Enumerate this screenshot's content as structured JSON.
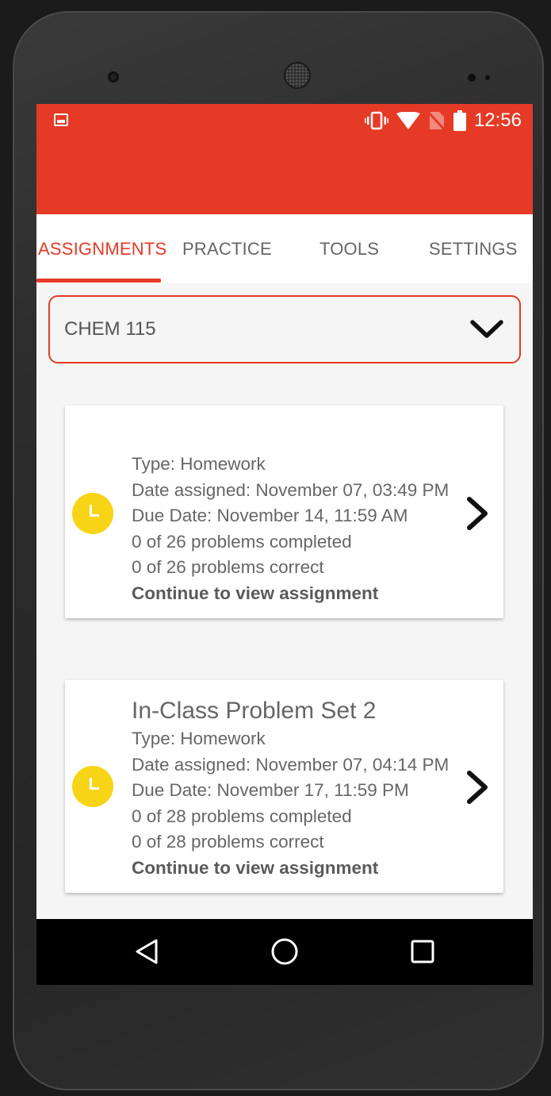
{
  "status_bar": {
    "time": "12:56",
    "icons": [
      "image-icon",
      "vibrate-icon",
      "wifi-icon",
      "no-sim-icon",
      "battery-icon"
    ]
  },
  "tabs": [
    {
      "label": "ASSIGNMENTS",
      "active": true
    },
    {
      "label": "PRACTICE",
      "active": false
    },
    {
      "label": "TOOLS",
      "active": false
    },
    {
      "label": "SETTINGS",
      "active": false
    }
  ],
  "course_selector": {
    "value": "CHEM 115",
    "icon": "chevron-down-icon"
  },
  "assignments": [
    {
      "title": "",
      "type": "Type: Homework",
      "date_assigned": "Date assigned: November 07, 03:49 PM",
      "due_date": "Due Date: November 14, 11:59 AM",
      "completed": "0 of 26 problems completed",
      "correct": "0 of 26 problems correct",
      "cta": "Continue to view assignment",
      "status_icon": "clock-icon"
    },
    {
      "title": "In-Class Problem Set 2",
      "type": "Type: Homework",
      "date_assigned": "Date assigned: November 07, 04:14 PM",
      "due_date": "Due Date: November 17, 11:59 PM",
      "completed": "0 of 28 problems completed",
      "correct": "0 of 28 problems correct",
      "cta": "Continue to view assignment",
      "status_icon": "clock-icon"
    }
  ],
  "nav_bar": [
    "back-icon",
    "home-icon",
    "recents-icon"
  ],
  "colors": {
    "accent": "#e53a26",
    "clock": "#f7d516"
  }
}
